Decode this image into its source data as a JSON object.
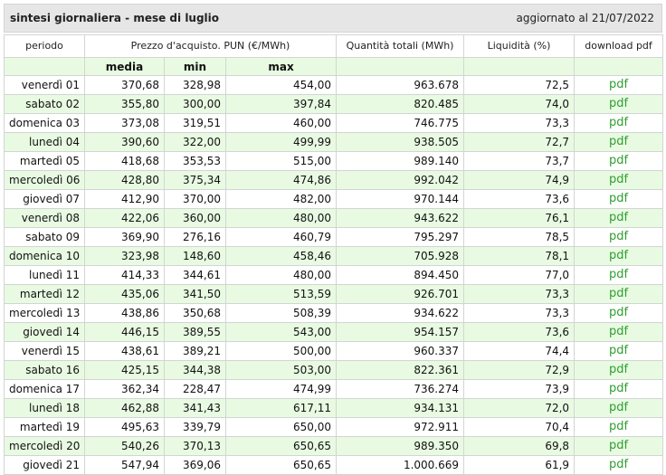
{
  "header": {
    "title": "sintesi giornaliera - mese di luglio",
    "updated": "aggiornato al 21/07/2022"
  },
  "columns": {
    "period": "periodo",
    "price": "Prezzo d'acquisto. PUN (€/MWh)",
    "quantity": "Quantità totali (MWh)",
    "liquidity": "Liquidità (%)",
    "download": "download pdf",
    "media": "media",
    "min": "min",
    "max": "max"
  },
  "rows": [
    {
      "day": "venerdì 01",
      "media": "370,68",
      "min": "328,98",
      "max": "454,00",
      "qty": "963.678",
      "liq": "72,5",
      "pdf": "pdf"
    },
    {
      "day": "sabato 02",
      "media": "355,80",
      "min": "300,00",
      "max": "397,84",
      "qty": "820.485",
      "liq": "74,0",
      "pdf": "pdf"
    },
    {
      "day": "domenica 03",
      "media": "373,08",
      "min": "319,51",
      "max": "460,00",
      "qty": "746.775",
      "liq": "73,3",
      "pdf": "pdf"
    },
    {
      "day": "lunedì 04",
      "media": "390,60",
      "min": "322,00",
      "max": "499,99",
      "qty": "938.505",
      "liq": "72,7",
      "pdf": "pdf"
    },
    {
      "day": "martedì 05",
      "media": "418,68",
      "min": "353,53",
      "max": "515,00",
      "qty": "989.140",
      "liq": "73,7",
      "pdf": "pdf"
    },
    {
      "day": "mercoledì 06",
      "media": "428,80",
      "min": "375,34",
      "max": "474,86",
      "qty": "992.042",
      "liq": "74,9",
      "pdf": "pdf"
    },
    {
      "day": "giovedì 07",
      "media": "412,90",
      "min": "370,00",
      "max": "482,00",
      "qty": "970.144",
      "liq": "73,6",
      "pdf": "pdf"
    },
    {
      "day": "venerdì 08",
      "media": "422,06",
      "min": "360,00",
      "max": "480,00",
      "qty": "943.622",
      "liq": "76,1",
      "pdf": "pdf"
    },
    {
      "day": "sabato 09",
      "media": "369,90",
      "min": "276,16",
      "max": "460,79",
      "qty": "795.297",
      "liq": "78,5",
      "pdf": "pdf"
    },
    {
      "day": "domenica 10",
      "media": "323,98",
      "min": "148,60",
      "max": "458,46",
      "qty": "705.928",
      "liq": "78,1",
      "pdf": "pdf"
    },
    {
      "day": "lunedì 11",
      "media": "414,33",
      "min": "344,61",
      "max": "480,00",
      "qty": "894.450",
      "liq": "77,0",
      "pdf": "pdf"
    },
    {
      "day": "martedì 12",
      "media": "435,06",
      "min": "341,50",
      "max": "513,59",
      "qty": "926.701",
      "liq": "73,3",
      "pdf": "pdf"
    },
    {
      "day": "mercoledì 13",
      "media": "438,86",
      "min": "350,68",
      "max": "508,39",
      "qty": "934.622",
      "liq": "73,3",
      "pdf": "pdf"
    },
    {
      "day": "giovedì 14",
      "media": "446,15",
      "min": "389,55",
      "max": "543,00",
      "qty": "954.157",
      "liq": "73,6",
      "pdf": "pdf"
    },
    {
      "day": "venerdì 15",
      "media": "438,61",
      "min": "389,21",
      "max": "500,00",
      "qty": "960.337",
      "liq": "74,4",
      "pdf": "pdf"
    },
    {
      "day": "sabato 16",
      "media": "425,15",
      "min": "344,38",
      "max": "503,00",
      "qty": "822.361",
      "liq": "72,9",
      "pdf": "pdf"
    },
    {
      "day": "domenica 17",
      "media": "362,34",
      "min": "228,47",
      "max": "474,99",
      "qty": "736.274",
      "liq": "73,9",
      "pdf": "pdf"
    },
    {
      "day": "lunedì 18",
      "media": "462,88",
      "min": "341,43",
      "max": "617,11",
      "qty": "934.131",
      "liq": "72,0",
      "pdf": "pdf"
    },
    {
      "day": "martedì 19",
      "media": "495,63",
      "min": "339,79",
      "max": "650,00",
      "qty": "972.911",
      "liq": "70,4",
      "pdf": "pdf"
    },
    {
      "day": "mercoledì 20",
      "media": "540,26",
      "min": "370,13",
      "max": "650,65",
      "qty": "989.350",
      "liq": "69,8",
      "pdf": "pdf"
    },
    {
      "day": "giovedì 21",
      "media": "547,94",
      "min": "369,06",
      "max": "650,65",
      "qty": "1.000.669",
      "liq": "61,9",
      "pdf": "pdf"
    }
  ]
}
